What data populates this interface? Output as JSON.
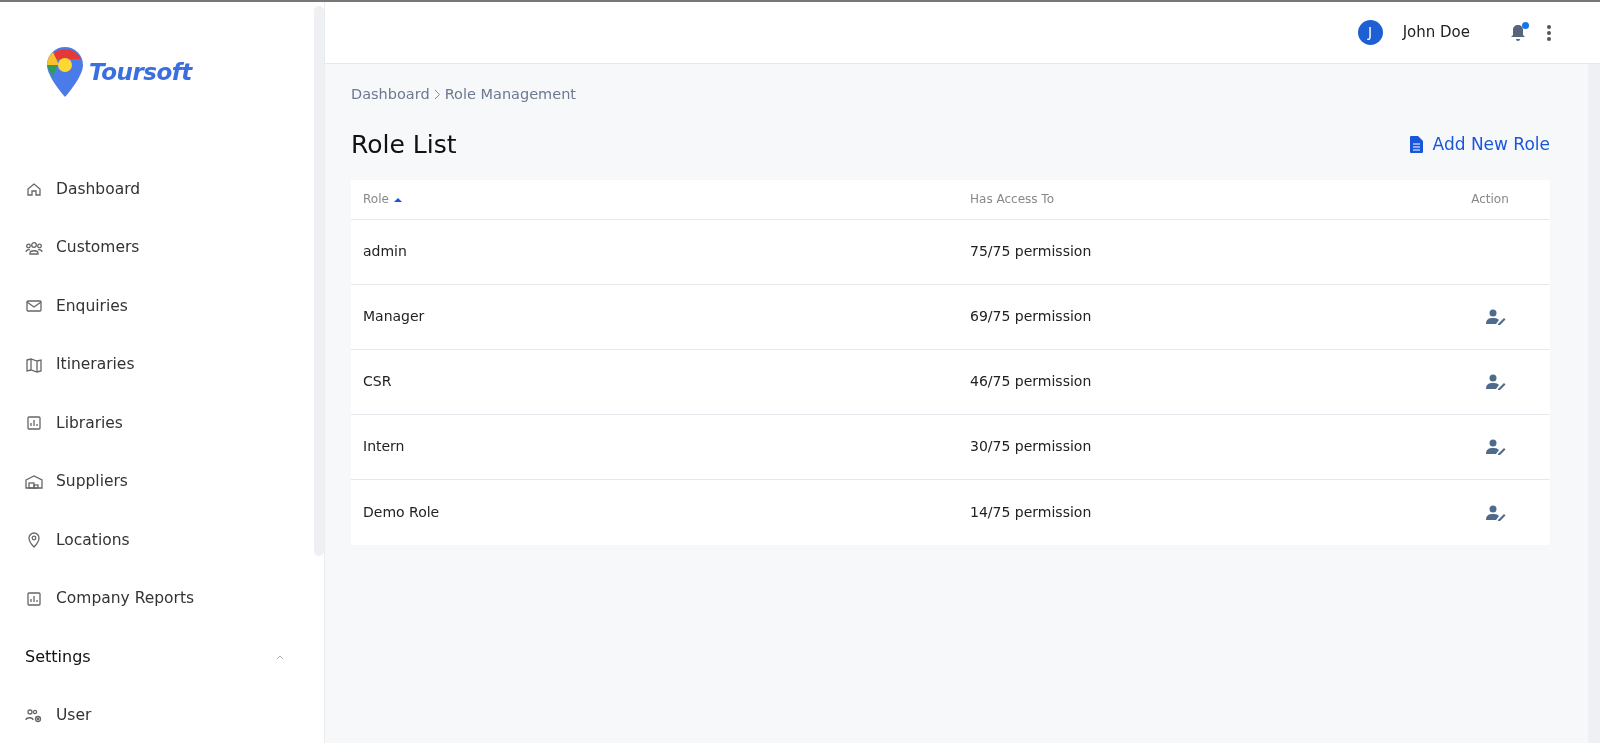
{
  "brand": {
    "name": "Toursoft"
  },
  "sidebar": {
    "items": [
      {
        "label": "Dashboard",
        "kind": "link"
      },
      {
        "label": "Customers",
        "kind": "link"
      },
      {
        "label": "Enquiries",
        "kind": "link"
      },
      {
        "label": "Itineraries",
        "kind": "link"
      },
      {
        "label": "Libraries",
        "kind": "link"
      },
      {
        "label": "Suppliers",
        "kind": "link"
      },
      {
        "label": "Locations",
        "kind": "link"
      },
      {
        "label": "Company Reports",
        "kind": "link"
      },
      {
        "label": "Settings",
        "kind": "section",
        "expanded": true
      },
      {
        "label": "User",
        "kind": "link"
      }
    ]
  },
  "header": {
    "user": {
      "initial": "J",
      "name": "John Doe"
    },
    "notifications": {
      "unread": true
    }
  },
  "breadcrumb": [
    "Dashboard",
    "Role Management"
  ],
  "page_title": "Role List",
  "add_button": "Add New Role",
  "table": {
    "columns": [
      {
        "label": "Role",
        "sorted": true
      },
      {
        "label": "Has Access To"
      },
      {
        "label": "Action"
      }
    ],
    "rows": [
      {
        "role": "admin",
        "access": "75/75 permission",
        "editable": false
      },
      {
        "role": "Manager",
        "access": "69/75 permission",
        "editable": true
      },
      {
        "role": "CSR",
        "access": "46/75 permission",
        "editable": true
      },
      {
        "role": "Intern",
        "access": "30/75 permission",
        "editable": true
      },
      {
        "role": "Demo Role",
        "access": "14/75 permission",
        "editable": true
      }
    ]
  }
}
